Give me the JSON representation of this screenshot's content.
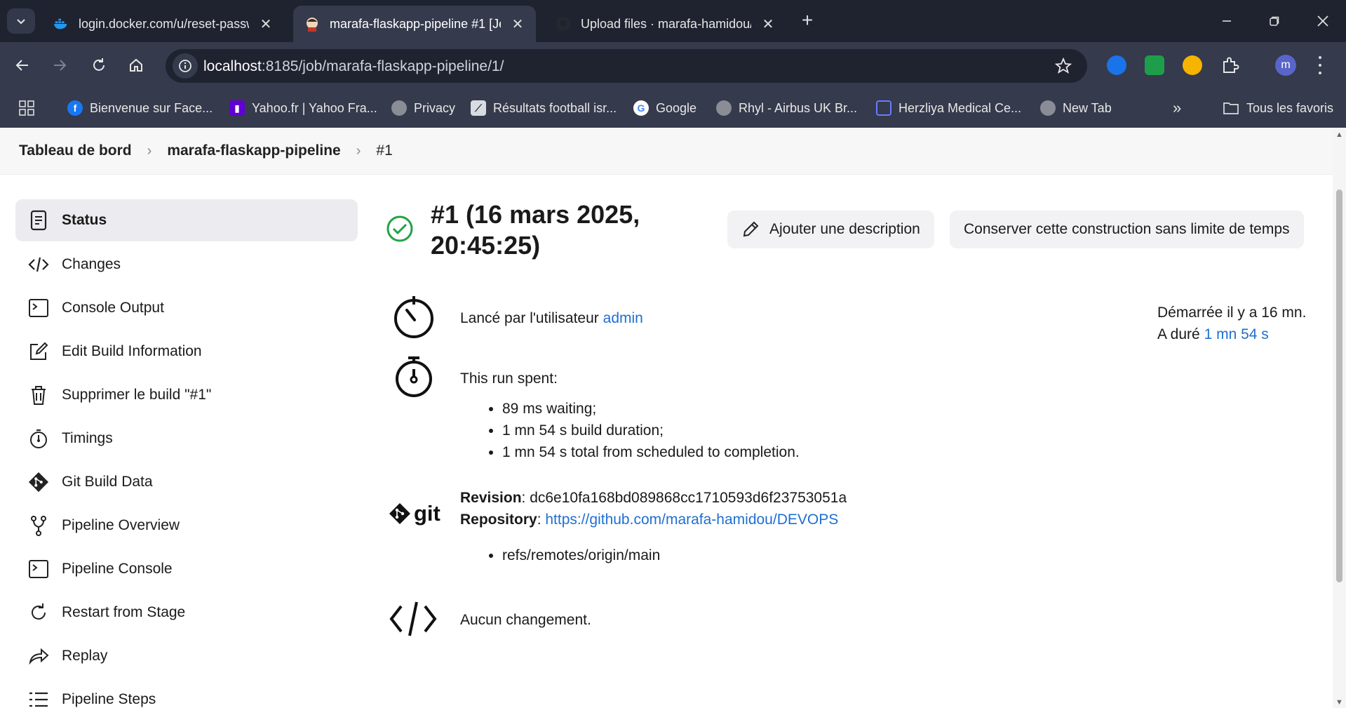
{
  "browser": {
    "tabs": [
      {
        "title": "login.docker.com/u/reset-passw",
        "active": false
      },
      {
        "title": "marafa-flaskapp-pipeline #1 [Je",
        "active": true
      },
      {
        "title": "Upload files · marafa-hamidou/",
        "active": false
      }
    ],
    "url_host": "localhost",
    "url_path": ":8185/job/marafa-flaskapp-pipeline/1/",
    "profile_initial": "m",
    "bookmarks": [
      "Bienvenue sur Face...",
      "Yahoo.fr | Yahoo Fra...",
      "Privacy",
      "Résultats football isr...",
      "Google",
      "Rhyl - Airbus UK Br...",
      "Herzliya Medical Ce...",
      "New Tab"
    ],
    "all_bookmarks": "Tous les favoris"
  },
  "breadcrumb": {
    "items": [
      "Tableau de bord",
      "marafa-flaskapp-pipeline",
      "#1"
    ]
  },
  "sidebar": {
    "items": [
      {
        "label": "Status",
        "icon": "document-icon"
      },
      {
        "label": "Changes",
        "icon": "code-icon"
      },
      {
        "label": "Console Output",
        "icon": "terminal-icon"
      },
      {
        "label": "Edit Build Information",
        "icon": "edit-icon"
      },
      {
        "label": "Supprimer le build \"#1\"",
        "icon": "trash-icon"
      },
      {
        "label": "Timings",
        "icon": "stopwatch-icon"
      },
      {
        "label": "Git Build Data",
        "icon": "git-icon"
      },
      {
        "label": "Pipeline Overview",
        "icon": "branch-icon"
      },
      {
        "label": "Pipeline Console",
        "icon": "terminal-icon"
      },
      {
        "label": "Restart from Stage",
        "icon": "restart-icon"
      },
      {
        "label": "Replay",
        "icon": "replay-icon"
      },
      {
        "label": "Pipeline Steps",
        "icon": "list-icon"
      }
    ]
  },
  "build": {
    "title_line1": "#1 (16 mars 2025,",
    "title_line2": "20:45:25)",
    "add_description": "Ajouter une description",
    "keep_forever": "Conserver cette construction sans limite de temps",
    "started_by_prefix": "Lancé par l'utilisateur",
    "started_by_user": "admin",
    "started_ago": "Démarrée il y a 16 mn.",
    "duration_prefix": "A duré",
    "duration": "1 mn 54 s",
    "run_spent_label": "This run spent:",
    "run_spent": [
      "89 ms waiting;",
      "1 mn 54 s build duration;",
      "1 mn 54 s total from scheduled to completion."
    ],
    "revision_label": "Revision",
    "revision": "dc6e10fa168bd089868cc1710593d6f23753051a",
    "repository_label": "Repository",
    "repository": "https://github.com/marafa-hamidou/DEVOPS",
    "refs": [
      "refs/remotes/origin/main"
    ],
    "git_logo_text": "git",
    "no_changes": "Aucun changement."
  }
}
